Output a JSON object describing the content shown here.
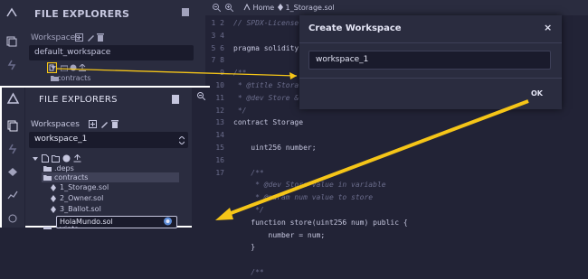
{
  "background": {
    "sidebar": {
      "title": "FILE EXPLORERS",
      "workspaces_label": "Workspaces",
      "workspace_selected": "default_workspace",
      "folder_contracts": "contracts"
    },
    "tabs": {
      "home": "Home",
      "file": "1_Storage.sol"
    },
    "line_numbers": "1\n2\n3\n4\n5\n6\n7\n8\n9\n10\n11\n12\n13\n14\n15\n16\n17",
    "code": {
      "l1": "// SPDX-License-",
      "l3": "pragma solidity",
      "l5": "/**",
      "l6": " * @title Stora",
      "l7": " * @dev Store & r",
      "l8": " */",
      "l9": "contract Storage",
      "l11": "    uint256 number;",
      "l13": "    /**",
      "l14": "     * @dev Store value in variable",
      "l15": "     * @param num value to store",
      "l16": "     */",
      "l17": "    function store(uint256 num) public {",
      "l18": "        number = num;",
      "l19": "    }",
      "l21": "    /**"
    }
  },
  "modal": {
    "title": "Create Workspace",
    "close": "×",
    "input_value": "workspace_1",
    "ok_label": "OK"
  },
  "zoom_panel": {
    "title": "FILE EXPLORERS",
    "workspaces_label": "Workspaces",
    "workspace_selected": "workspace_1",
    "tree": {
      "deps": ".deps",
      "contracts": "contracts",
      "file1": "1_Storage.sol",
      "file2": "2_Owner.sol",
      "file3": "3_Ballot.sol",
      "new_file": "HolaMundo.sol",
      "scripts": "scripts"
    }
  },
  "colors": {
    "annotation_arrow": "#f5c518",
    "highlight_box": "#f5c518",
    "panel_border": "#ffffff"
  }
}
